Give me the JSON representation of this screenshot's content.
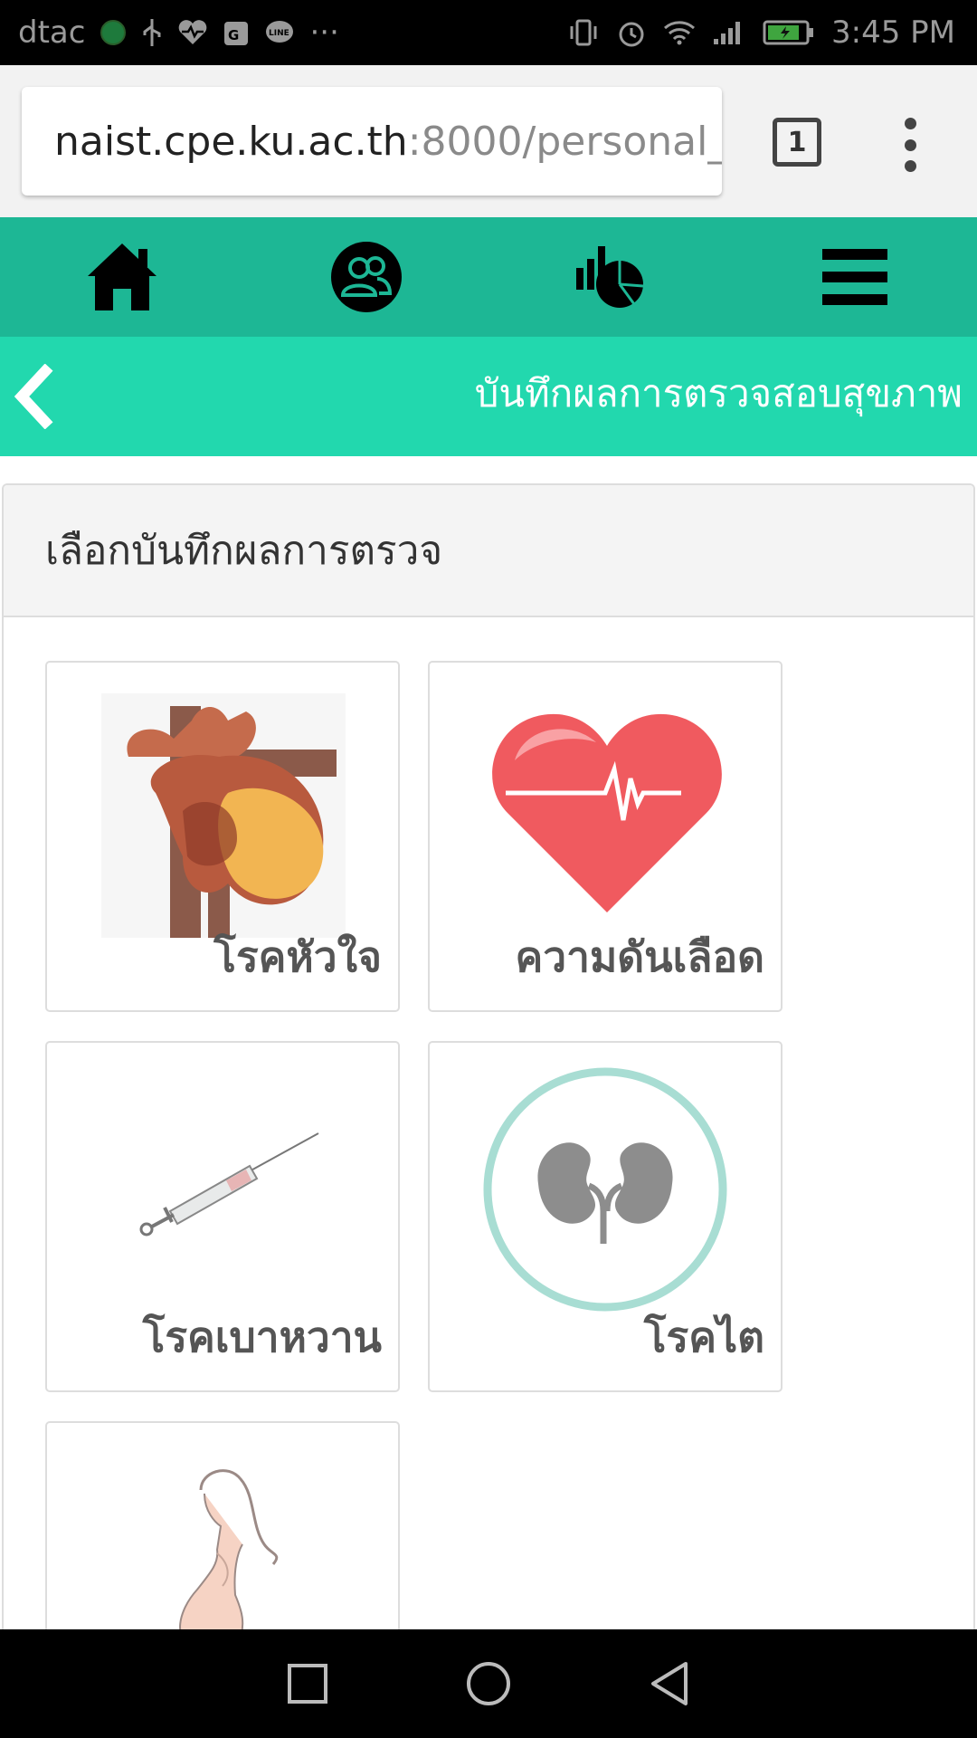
{
  "status_bar": {
    "carrier": "dtac",
    "more": "···",
    "time": "3:45 PM"
  },
  "browser": {
    "url_host": "naist.cpe.ku.ac.th",
    "url_path": ":8000/personal_",
    "tab_count": "1"
  },
  "nav": {
    "items": [
      "home-icon",
      "users-icon",
      "statistics-icon",
      "hamburger-menu-icon"
    ]
  },
  "subheader": {
    "title": "บันทึกผลการตรวจสอบสุขภาพ"
  },
  "panel": {
    "heading": "เลือกบันทึกผลการตรวจ",
    "tiles": [
      {
        "label": "โรคหัวใจ",
        "icon": "heart-anatomy-icon"
      },
      {
        "label": "ความดันเลือด",
        "icon": "heart-pulse-icon"
      },
      {
        "label": "โรคเบาหวาน",
        "icon": "syringe-icon"
      },
      {
        "label": "โรคไต",
        "icon": "kidney-icon"
      },
      {
        "label": "",
        "icon": "pregnant-woman-icon"
      }
    ]
  },
  "colors": {
    "nav_bg": "#1db795",
    "subheader_bg": "#22d8ae"
  }
}
